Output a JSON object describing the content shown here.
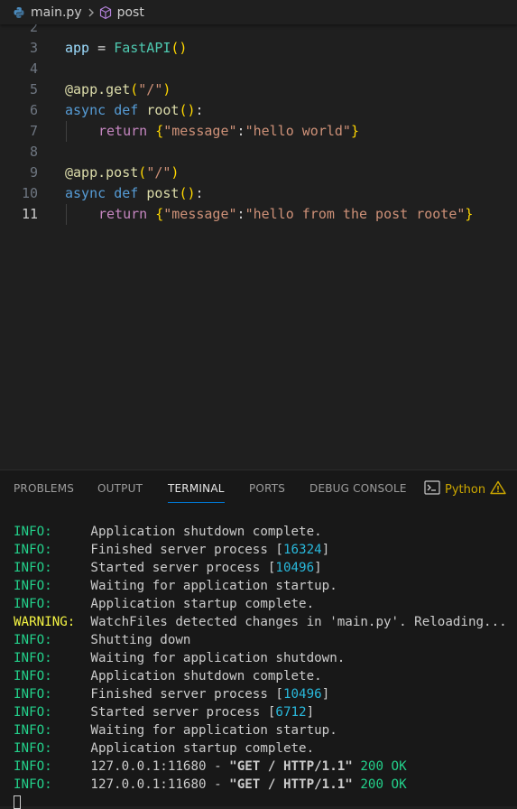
{
  "breadcrumb": {
    "file": "main.py",
    "symbol": "post"
  },
  "editor": {
    "lines": [
      {
        "n": "2"
      },
      {
        "n": "3",
        "tokens": [
          [
            "var",
            "app"
          ],
          [
            "op",
            " = "
          ],
          [
            "cls",
            "FastAPI"
          ],
          [
            "br1",
            "()"
          ]
        ]
      },
      {
        "n": "4"
      },
      {
        "n": "5",
        "tokens": [
          [
            "dec",
            "@app.get"
          ],
          [
            "br1",
            "("
          ],
          [
            "str",
            "\"/\""
          ],
          [
            "br1",
            ")"
          ]
        ]
      },
      {
        "n": "6",
        "tokens": [
          [
            "kw",
            "async"
          ],
          [
            "op",
            " "
          ],
          [
            "kw",
            "def"
          ],
          [
            "op",
            " "
          ],
          [
            "fn",
            "root"
          ],
          [
            "br1",
            "()"
          ],
          [
            "op",
            ":"
          ]
        ]
      },
      {
        "n": "7",
        "indent": true,
        "tokens": [
          [
            "kw2",
            "return"
          ],
          [
            "op",
            " "
          ],
          [
            "br1",
            "{"
          ],
          [
            "str",
            "\"message\""
          ],
          [
            "op",
            ":"
          ],
          [
            "str",
            "\"hello world\""
          ],
          [
            "br1",
            "}"
          ]
        ]
      },
      {
        "n": "8"
      },
      {
        "n": "9",
        "tokens": [
          [
            "dec",
            "@app.post"
          ],
          [
            "br1",
            "("
          ],
          [
            "str",
            "\"/\""
          ],
          [
            "br1",
            ")"
          ]
        ]
      },
      {
        "n": "10",
        "tokens": [
          [
            "kw",
            "async"
          ],
          [
            "op",
            " "
          ],
          [
            "kw",
            "def"
          ],
          [
            "op",
            " "
          ],
          [
            "fn",
            "post"
          ],
          [
            "br1",
            "()"
          ],
          [
            "op",
            ":"
          ]
        ]
      },
      {
        "n": "11",
        "active": true,
        "indent": true,
        "tokens": [
          [
            "kw2",
            "return"
          ],
          [
            "op",
            " "
          ],
          [
            "br1",
            "{"
          ],
          [
            "str",
            "\"message\""
          ],
          [
            "op",
            ":"
          ],
          [
            "str",
            "\"hello from the post roote\""
          ],
          [
            "br1",
            "}"
          ]
        ]
      }
    ]
  },
  "panel": {
    "tabs": [
      {
        "label": "PROBLEMS"
      },
      {
        "label": "OUTPUT"
      },
      {
        "label": "TERMINAL",
        "active": true
      },
      {
        "label": "PORTS"
      },
      {
        "label": "DEBUG CONSOLE"
      }
    ],
    "terminal_selector": "Python",
    "terminal": [
      {
        "level": "INFO:",
        "kind": "info",
        "parts": [
          [
            "t",
            "Application shutdown complete."
          ]
        ]
      },
      {
        "level": "INFO:",
        "kind": "info",
        "parts": [
          [
            "t",
            "Finished server process ["
          ],
          [
            "num",
            "16324"
          ],
          [
            "t",
            "]"
          ]
        ]
      },
      {
        "level": "INFO:",
        "kind": "info",
        "parts": [
          [
            "t",
            "Started server process ["
          ],
          [
            "num",
            "10496"
          ],
          [
            "t",
            "]"
          ]
        ]
      },
      {
        "level": "INFO:",
        "kind": "info",
        "parts": [
          [
            "t",
            "Waiting for application startup."
          ]
        ]
      },
      {
        "level": "INFO:",
        "kind": "info",
        "parts": [
          [
            "t",
            "Application startup complete."
          ]
        ]
      },
      {
        "level": "WARNING:",
        "kind": "warn",
        "parts": [
          [
            "t",
            "WatchFiles detected changes in 'main.py'. Reloading..."
          ]
        ]
      },
      {
        "level": "INFO:",
        "kind": "info",
        "parts": [
          [
            "t",
            "Shutting down"
          ]
        ]
      },
      {
        "level": "INFO:",
        "kind": "info",
        "parts": [
          [
            "t",
            "Waiting for application shutdown."
          ]
        ]
      },
      {
        "level": "INFO:",
        "kind": "info",
        "parts": [
          [
            "t",
            "Application shutdown complete."
          ]
        ]
      },
      {
        "level": "INFO:",
        "kind": "info",
        "parts": [
          [
            "t",
            "Finished server process ["
          ],
          [
            "num",
            "10496"
          ],
          [
            "t",
            "]"
          ]
        ]
      },
      {
        "level": "INFO:",
        "kind": "info",
        "parts": [
          [
            "t",
            "Started server process ["
          ],
          [
            "num",
            "6712"
          ],
          [
            "t",
            "]"
          ]
        ]
      },
      {
        "level": "INFO:",
        "kind": "info",
        "parts": [
          [
            "t",
            "Waiting for application startup."
          ]
        ]
      },
      {
        "level": "INFO:",
        "kind": "info",
        "parts": [
          [
            "t",
            "Application startup complete."
          ]
        ]
      },
      {
        "level": "INFO:",
        "kind": "info",
        "parts": [
          [
            "t",
            "127.0.0.1:11680 - "
          ],
          [
            "bold",
            "\"GET / HTTP/1.1\""
          ],
          [
            "t",
            " "
          ],
          [
            "ok",
            "200 OK"
          ]
        ]
      },
      {
        "level": "INFO:",
        "kind": "info",
        "parts": [
          [
            "t",
            "127.0.0.1:11680 - "
          ],
          [
            "bold",
            "\"GET / HTTP/1.1\""
          ],
          [
            "t",
            " "
          ],
          [
            "ok",
            "200 OK"
          ]
        ]
      }
    ]
  },
  "colors": {
    "accent": "#0078d4",
    "info": "#23d18b",
    "warning": "#f5f543",
    "number": "#29b8db"
  },
  "icons": [
    "python-file-icon",
    "chevron-right-icon",
    "symbol-method-icon",
    "terminal-icon",
    "warning-icon"
  ]
}
